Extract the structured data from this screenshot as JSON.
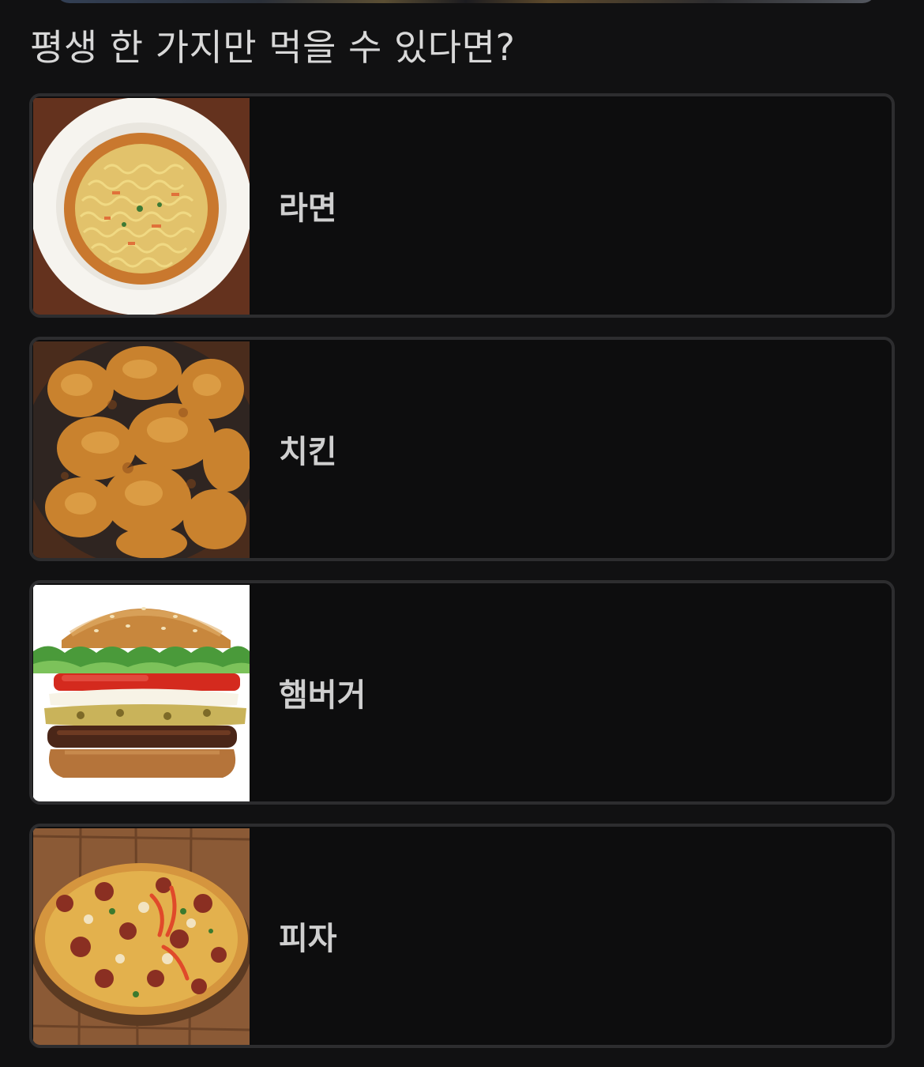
{
  "question": {
    "text": "평생 한 가지만 먹을 수 있다면?"
  },
  "options": [
    {
      "label": "라면",
      "image_icon": "ramen-image"
    },
    {
      "label": "치킨",
      "image_icon": "fried-chicken-image"
    },
    {
      "label": "햄버거",
      "image_icon": "hamburger-image"
    },
    {
      "label": "피자",
      "image_icon": "pizza-image"
    }
  ],
  "colors": {
    "background": "#111112",
    "card_border": "#2d2d2f",
    "card_background": "#0d0d0e",
    "question_text": "#d8d8d8",
    "label_text": "#cfcfcf"
  }
}
